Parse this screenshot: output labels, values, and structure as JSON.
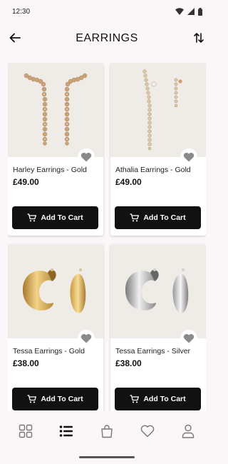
{
  "status_bar": {
    "time": "12:30",
    "icons": [
      "wifi-icon",
      "signal-icon",
      "battery-icon"
    ]
  },
  "header": {
    "title": "EARRINGS",
    "back_icon": "arrow-back-icon",
    "sort_icon": "sort-icon"
  },
  "products": [
    {
      "name": "Harley Earrings - Gold",
      "price": "£49.00",
      "cart_label": "Add To Cart",
      "image": "gold-heart-drop-earrings"
    },
    {
      "name": "Athalia Earrings - Gold",
      "price": "£49.00",
      "cart_label": "Add To Cart",
      "image": "gold-crystal-climber-earrings"
    },
    {
      "name": "Tessa Earrings - Gold",
      "price": "£38.00",
      "cart_label": "Add To Cart",
      "image": "gold-chunky-hoop-earrings"
    },
    {
      "name": "Tessa Earrings - Silver",
      "price": "£38.00",
      "cart_label": "Add To Cart",
      "image": "silver-chunky-hoop-earrings"
    }
  ],
  "bottom_nav": [
    "grid-view-icon",
    "list-view-icon",
    "shopping-bag-icon",
    "heart-icon",
    "person-icon"
  ],
  "colors": {
    "background": "#fbf7f8",
    "button": "#111111",
    "image_bg": "#efebe7",
    "fav_icon": "#8a8a8a"
  }
}
